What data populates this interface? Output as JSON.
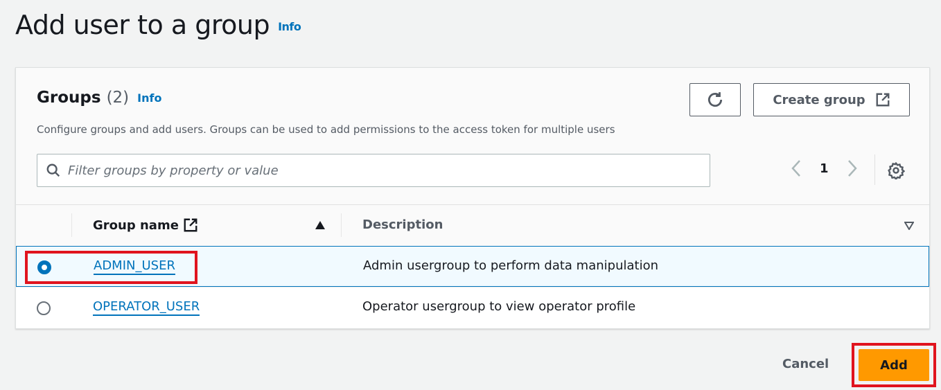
{
  "page": {
    "title": "Add user to a group",
    "info": "Info"
  },
  "groups": {
    "title": "Groups",
    "count": "(2)",
    "info": "Info",
    "description": "Configure groups and add users. Groups can be used to add permissions to the access token for multiple users",
    "create_label": "Create group",
    "filter_placeholder": "Filter groups by property or value",
    "page": "1"
  },
  "table": {
    "headers": [
      "Group name",
      "Description"
    ],
    "sort": "ascending",
    "rows": [
      {
        "name": "ADMIN_USER",
        "description": "Admin usergroup to perform data manipulation",
        "selected": true
      },
      {
        "name": "OPERATOR_USER",
        "description": "Operator usergroup to view operator profile",
        "selected": false
      }
    ]
  },
  "footer": {
    "cancel": "Cancel",
    "add": "Add"
  },
  "colors": {
    "accent": "#0073bb",
    "primary": "#ff9900",
    "highlight": "#e0141e"
  }
}
